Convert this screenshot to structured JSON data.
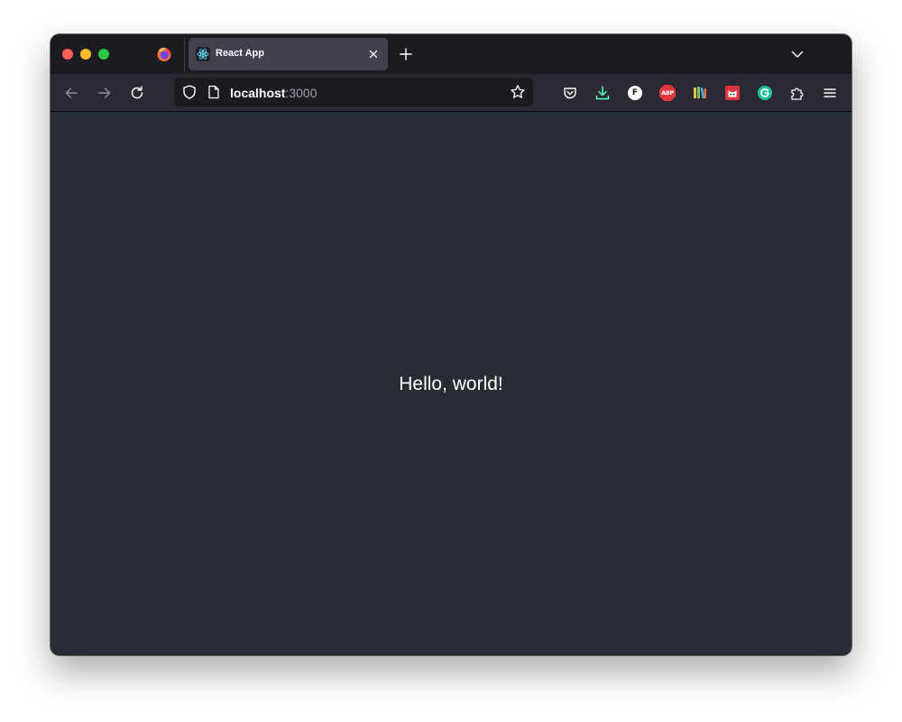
{
  "browser": {
    "tab": {
      "title": "React App",
      "favicon": "react-icon"
    },
    "toolbar": {
      "back_icon": "arrow-left-icon",
      "forward_icon": "arrow-right-icon",
      "reload_icon": "reload-icon",
      "extensions": [
        "pocket-icon",
        "download-icon",
        "f-extension-icon",
        "adblock-plus-icon",
        "library-books-icon",
        "cat-extension-icon",
        "grammarly-icon",
        "extensions-puzzle-icon",
        "menu-icon"
      ]
    },
    "urlbar": {
      "host": "localhost",
      "port": ":3000"
    },
    "badges": {
      "f_extension": "F",
      "adblock": "ABP"
    },
    "colors": {
      "tabstrip": "#1c1b22",
      "navbar": "#2b2a33",
      "active_tab": "#42414d",
      "content_bg": "#282c34",
      "react_accent": "#61dafb",
      "download_accent": "#54ffbd"
    }
  },
  "page": {
    "message": "Hello, world!"
  }
}
